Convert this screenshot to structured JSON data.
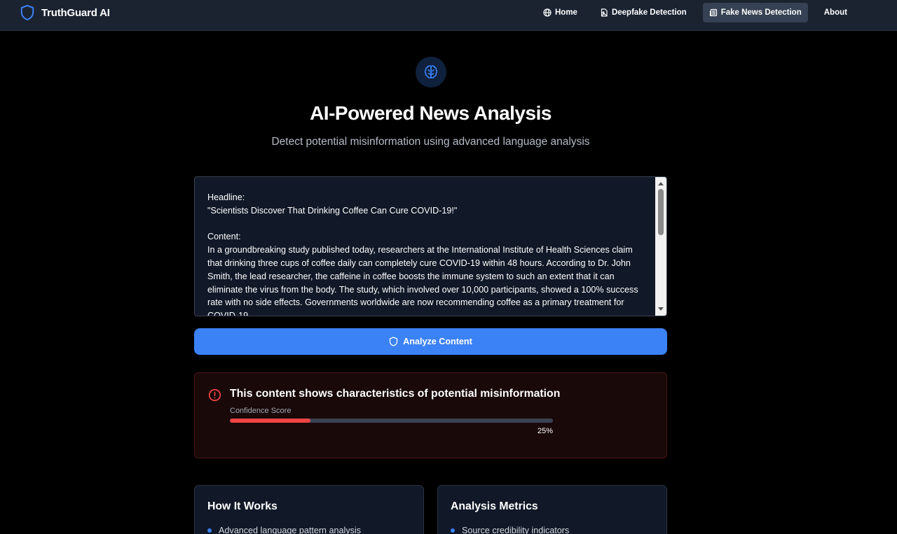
{
  "brand": {
    "name": "TruthGuard AI",
    "icon": "shield-icon"
  },
  "nav": {
    "items": [
      {
        "label": "Home",
        "icon": "globe-icon"
      },
      {
        "label": "Deepfake Detection",
        "icon": "file-image-icon"
      },
      {
        "label": "Fake News Detection",
        "icon": "newspaper-icon",
        "active": true
      },
      {
        "label": "About"
      }
    ]
  },
  "hero": {
    "icon": "brain-icon",
    "title": "AI-Powered News Analysis",
    "subtitle": "Detect potential misinformation using advanced language analysis"
  },
  "article": {
    "value": "Headline:\n\"Scientists Discover That Drinking Coffee Can Cure COVID-19!\"\n\nContent:\nIn a groundbreaking study published today, researchers at the International Institute of Health Sciences claim that drinking three cups of coffee daily can completely cure COVID-19 within 48 hours. According to Dr. John Smith, the lead researcher, the caffeine in coffee boosts the immune system to such an extent that it can eliminate the virus from the body. The study, which involved over 10,000 participants, showed a 100% success rate with no side effects. Governments worldwide are now recommending coffee as a primary treatment for COVID-19."
  },
  "analyze_button": {
    "label": "Analyze Content",
    "icon": "shield-icon"
  },
  "result": {
    "icon": "alert-circle-icon",
    "title": "This content shows characteristics of potential misinformation",
    "score_label": "Confidence Score",
    "score_value": "25%",
    "score_fraction": 0.25
  },
  "cards": {
    "how_it_works": {
      "title": "How It Works",
      "items": [
        "Advanced language pattern analysis"
      ]
    },
    "metrics": {
      "title": "Analysis Metrics",
      "items": [
        "Source credibility indicators"
      ]
    }
  },
  "colors": {
    "accent": "#3b82f6",
    "danger": "#ef4444",
    "nav_bg": "#1b2331",
    "card_bg": "#111827"
  }
}
